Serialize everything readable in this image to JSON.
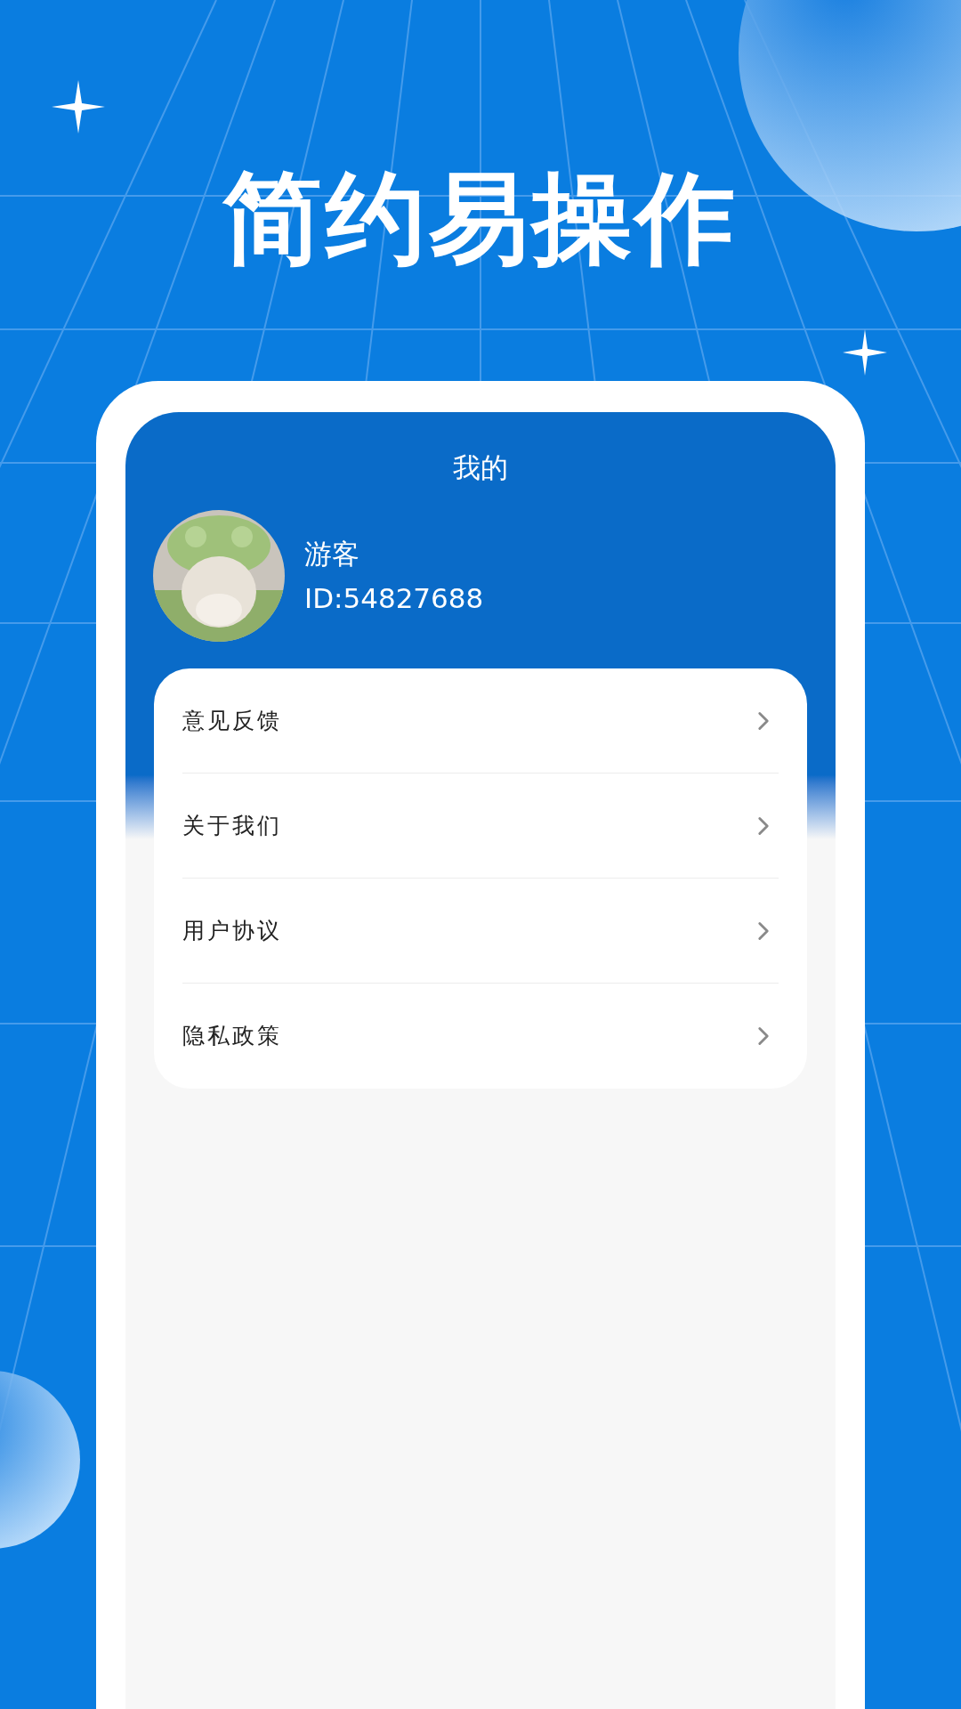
{
  "headline": "简约易操作",
  "screen": {
    "title": "我的",
    "profile": {
      "name": "游客",
      "id": "ID:54827688"
    },
    "menu": [
      {
        "label": "意见反馈"
      },
      {
        "label": "关于我们"
      },
      {
        "label": "用户协议"
      },
      {
        "label": "隐私政策"
      }
    ]
  }
}
